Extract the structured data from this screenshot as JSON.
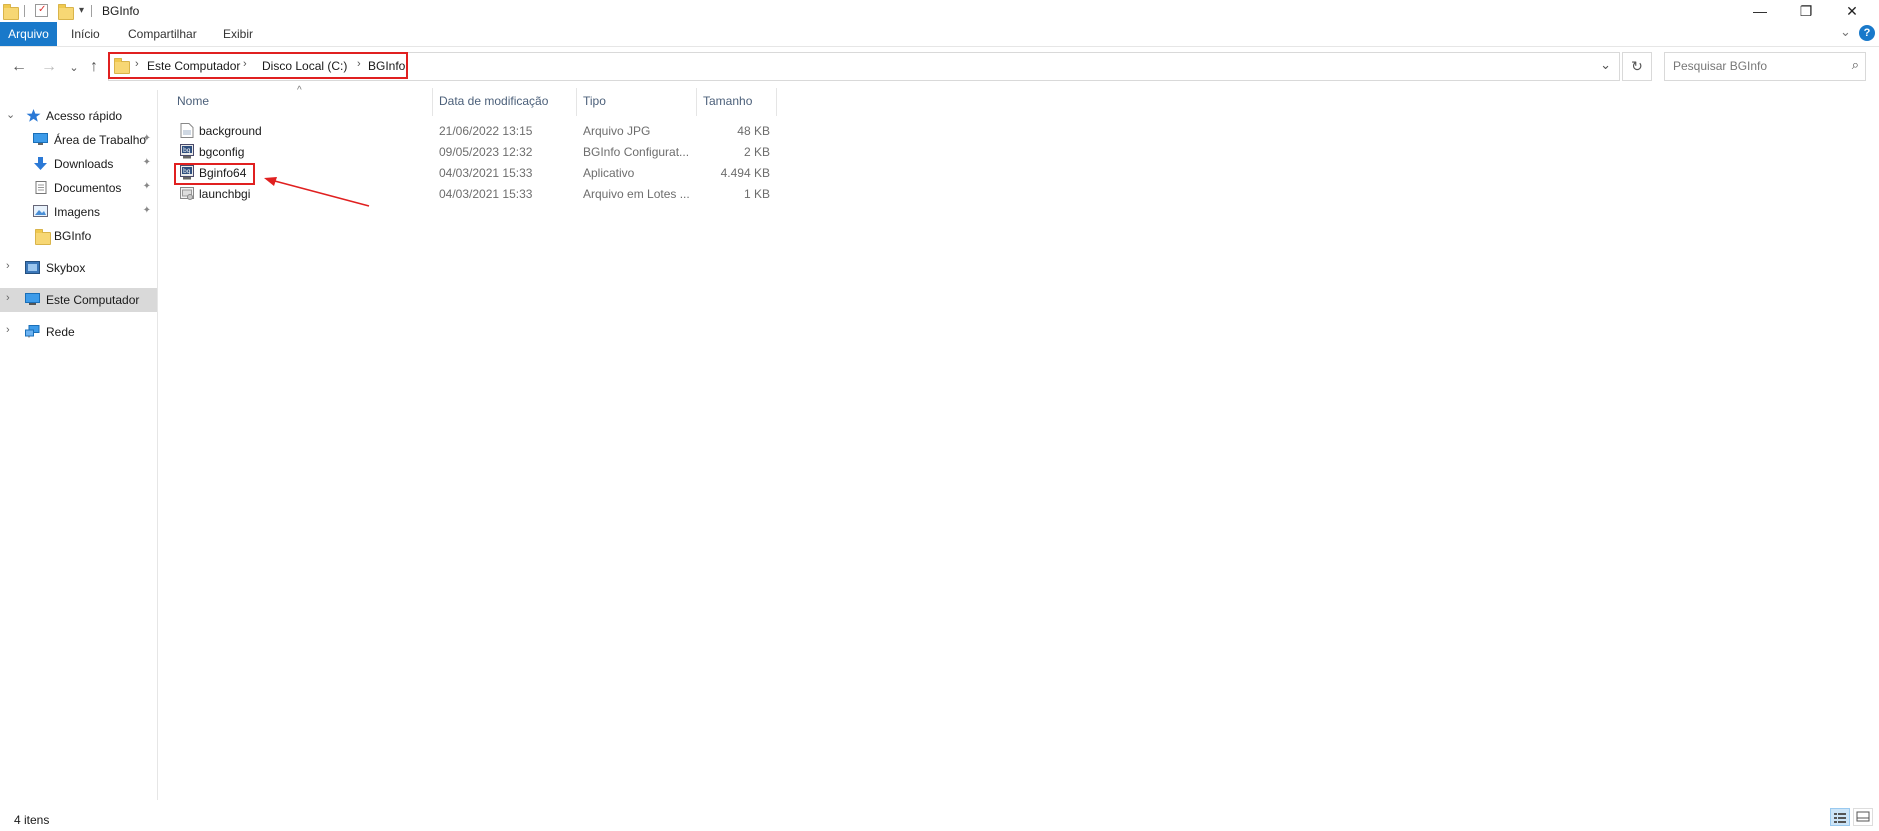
{
  "window": {
    "title": "BGInfo",
    "minimize_glyph": "—",
    "restore_glyph": "❐",
    "close_glyph": "✕"
  },
  "ribbon": {
    "tabs": [
      "Arquivo",
      "Início",
      "Compartilhar",
      "Exibir"
    ],
    "expand_glyph": "⌄",
    "help_glyph": "?"
  },
  "nav": {
    "back_glyph": "←",
    "forward_glyph": "→",
    "recent_glyph": "⌄",
    "up_glyph": "↑"
  },
  "address": {
    "crumbs": [
      "Este Computador",
      "Disco Local (C:)",
      "BGInfo"
    ],
    "separator": "›",
    "dropdown_glyph": "⌄",
    "refresh_glyph": "↻"
  },
  "search": {
    "placeholder": "Pesquisar BGInfo",
    "icon": "⌕"
  },
  "sidebar": {
    "items": [
      {
        "label": "Acesso rápido",
        "icon": "star-icon"
      },
      {
        "label": "Área de Trabalho",
        "icon": "desktop-icon",
        "pinned": true
      },
      {
        "label": "Downloads",
        "icon": "download-arrow-icon",
        "pinned": true
      },
      {
        "label": "Documentos",
        "icon": "document-icon",
        "pinned": true
      },
      {
        "label": "Imagens",
        "icon": "image-icon",
        "pinned": true
      },
      {
        "label": "BGInfo",
        "icon": "folder-icon"
      },
      {
        "label": "Skybox",
        "icon": "app-icon"
      },
      {
        "label": "Este Computador",
        "icon": "computer-icon",
        "selected": true
      },
      {
        "label": "Rede",
        "icon": "network-icon"
      }
    ],
    "pin_glyph": "📌",
    "expanded_glyph": "⌄",
    "collapsed_glyph": "›"
  },
  "columns": {
    "name": "Nome",
    "date": "Data de modificação",
    "type": "Tipo",
    "size": "Tamanho",
    "sort_glyph": "^"
  },
  "files": [
    {
      "name": "background",
      "date": "21/06/2022 13:15",
      "type": "Arquivo JPG",
      "size": "48 KB",
      "icon": "image-file-icon"
    },
    {
      "name": "bgconfig",
      "date": "09/05/2023 12:32",
      "type": "BGInfo Configurat...",
      "size": "2 KB",
      "icon": "bginfo-config-icon"
    },
    {
      "name": "Bginfo64",
      "date": "04/03/2021 15:33",
      "type": "Aplicativo",
      "size": "4.494 KB",
      "icon": "bginfo-app-icon",
      "highlighted": true
    },
    {
      "name": "launchbgi",
      "date": "04/03/2021 15:33",
      "type": "Arquivo em Lotes ...",
      "size": "1 KB",
      "icon": "batch-file-icon"
    }
  ],
  "status": {
    "item_count": "4 itens"
  },
  "colors": {
    "accent": "#1979ca",
    "highlight": "#e02020",
    "folder": "#f7d774"
  }
}
